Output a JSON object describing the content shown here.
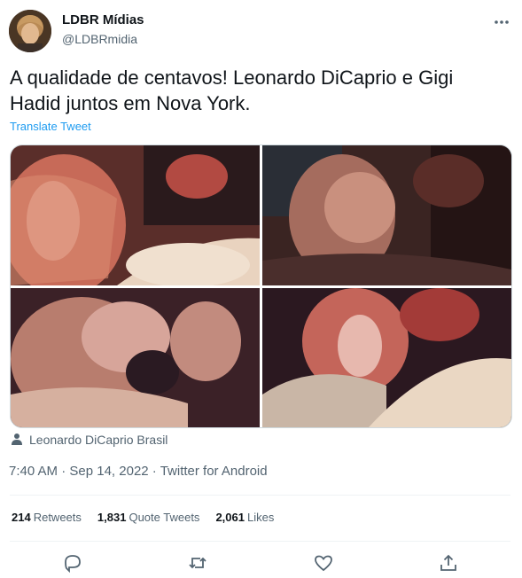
{
  "author": {
    "display_name": "LDBR Mídias",
    "handle": "@LDBRmidia",
    "avatar_icon": "avatar-photo"
  },
  "tweet": {
    "text": "A qualidade de centavos! Leonardo DiCaprio e Gigi Hadid juntos em Nova York.",
    "translate_label": "Translate Tweet",
    "media_count": 4,
    "tagged_user": "Leonardo DiCaprio Brasil",
    "time": "7:40 AM",
    "date": "Sep 14, 2022",
    "source": "Twitter for Android",
    "separator": " · "
  },
  "stats": {
    "retweets": {
      "count": "214",
      "label": "Retweets"
    },
    "quote_tweets": {
      "count": "1,831",
      "label": "Quote Tweets"
    },
    "likes": {
      "count": "2,061",
      "label": "Likes"
    }
  },
  "colors": {
    "text_primary": "#0f1419",
    "text_secondary": "#536471",
    "link": "#1d9bf0",
    "divider": "#eff3f4"
  },
  "icons": [
    "more-icon",
    "person-icon",
    "reply-icon",
    "retweet-icon",
    "like-icon",
    "share-icon"
  ]
}
